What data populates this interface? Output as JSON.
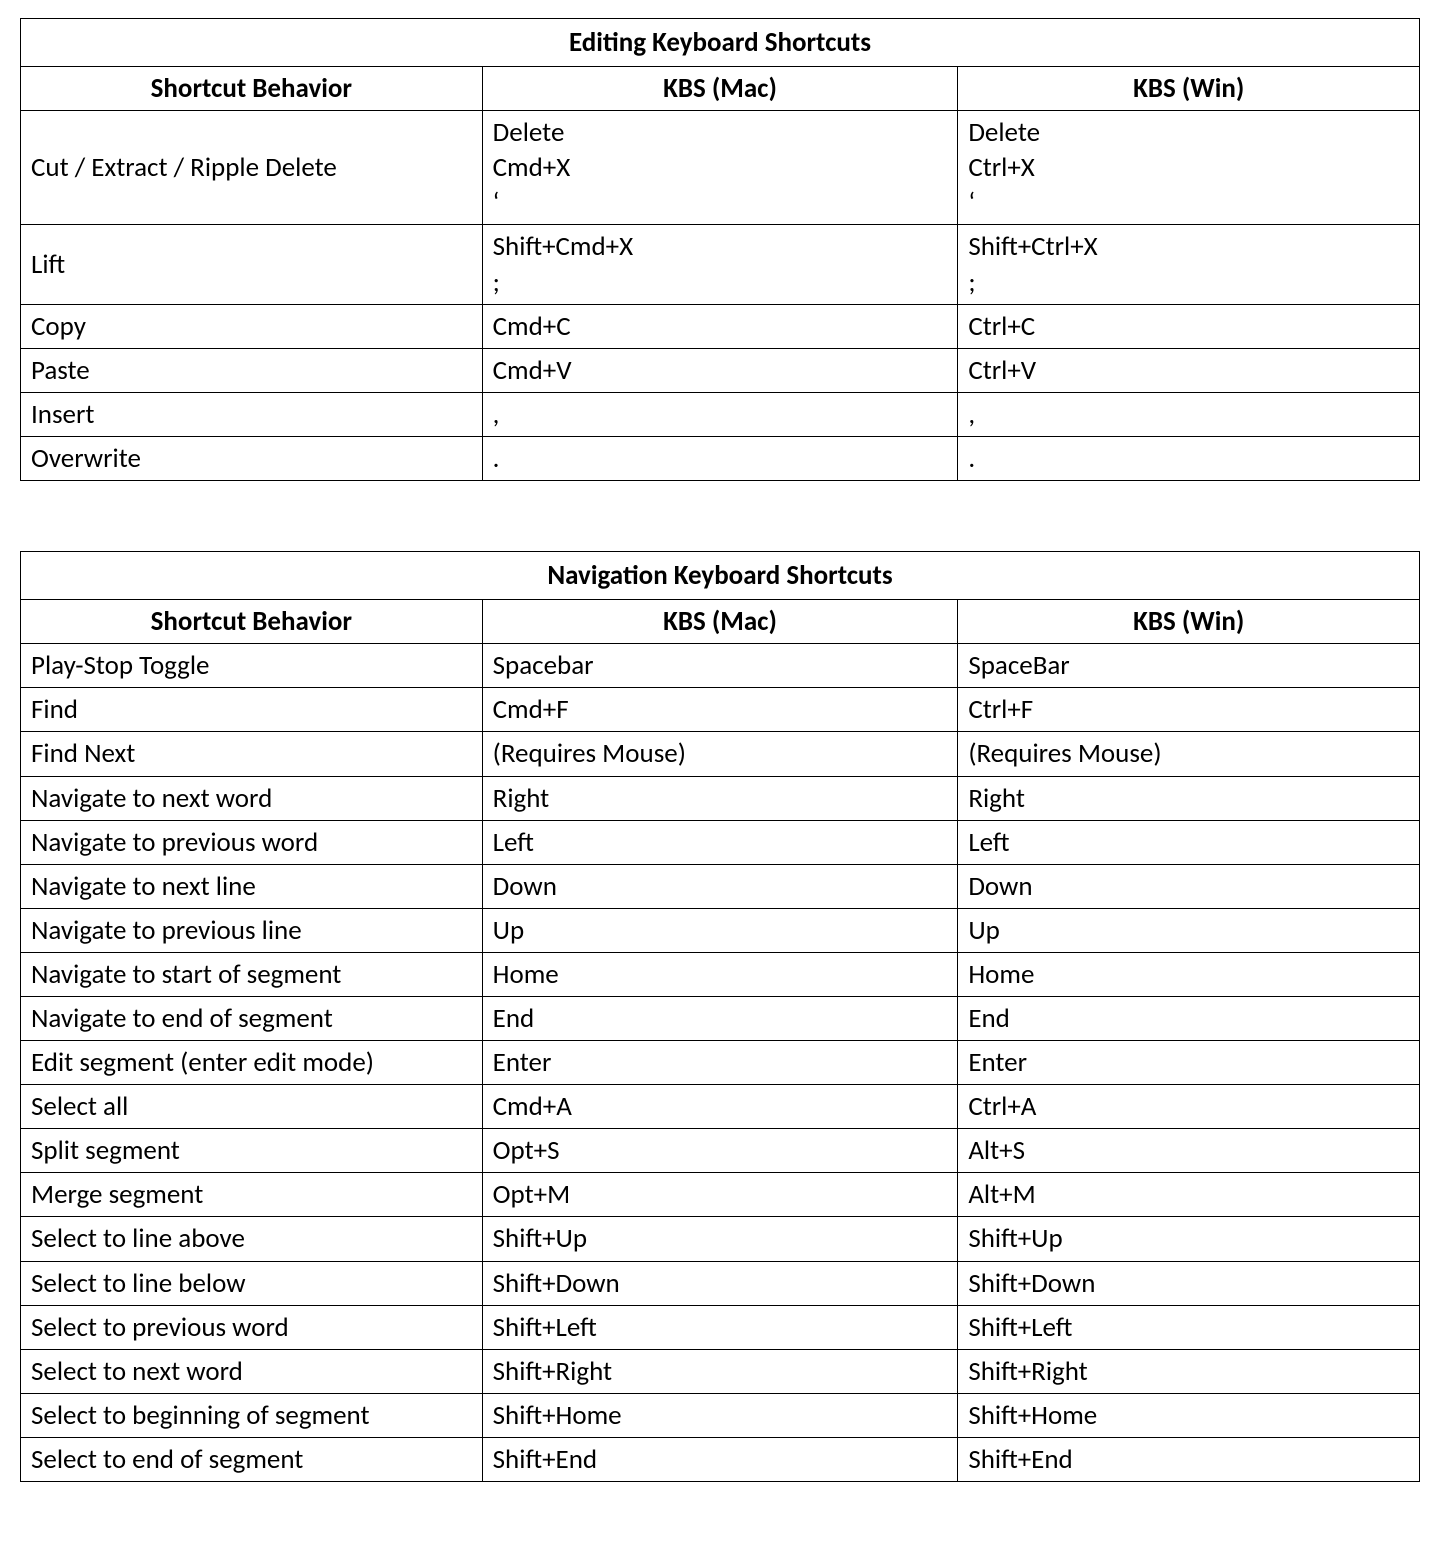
{
  "tables": [
    {
      "title": "Editing Keyboard Shortcuts",
      "columns": [
        "Shortcut Behavior",
        "KBS (Mac)",
        "KBS (Win)"
      ],
      "rows": [
        {
          "behavior": "Cut / Extract / Ripple Delete",
          "mac": [
            "Delete",
            "Cmd+X",
            "‘"
          ],
          "win": [
            "Delete",
            "Ctrl+X",
            "‘"
          ]
        },
        {
          "behavior": "Lift",
          "mac": [
            "Shift+Cmd+X",
            ";"
          ],
          "win": [
            "Shift+Ctrl+X",
            ";"
          ]
        },
        {
          "behavior": "Copy",
          "mac": [
            "Cmd+C"
          ],
          "win": [
            "Ctrl+C"
          ]
        },
        {
          "behavior": "Paste",
          "mac": [
            "Cmd+V"
          ],
          "win": [
            "Ctrl+V"
          ]
        },
        {
          "behavior": "Insert",
          "mac": [
            ","
          ],
          "win": [
            ","
          ]
        },
        {
          "behavior": "Overwrite",
          "mac": [
            "."
          ],
          "win": [
            "."
          ]
        }
      ]
    },
    {
      "title": "Navigation Keyboard Shortcuts",
      "columns": [
        "Shortcut Behavior",
        "KBS (Mac)",
        "KBS (Win)"
      ],
      "rows": [
        {
          "behavior": "Play-Stop Toggle",
          "mac": [
            "Spacebar"
          ],
          "win": [
            "SpaceBar"
          ]
        },
        {
          "behavior": "Find",
          "mac": [
            "Cmd+F"
          ],
          "win": [
            "Ctrl+F"
          ]
        },
        {
          "behavior": "Find Next",
          "mac": [
            "(Requires Mouse)"
          ],
          "win": [
            "(Requires Mouse)"
          ]
        },
        {
          "behavior": "Navigate to next word",
          "mac": [
            "Right"
          ],
          "win": [
            "Right"
          ]
        },
        {
          "behavior": "Navigate to previous word",
          "mac": [
            "Left"
          ],
          "win": [
            "Left"
          ]
        },
        {
          "behavior": "Navigate to next line",
          "mac": [
            "Down"
          ],
          "win": [
            "Down"
          ]
        },
        {
          "behavior": "Navigate to previous line",
          "mac": [
            "Up"
          ],
          "win": [
            "Up"
          ]
        },
        {
          "behavior": "Navigate to start of segment",
          "mac": [
            "Home"
          ],
          "win": [
            "Home"
          ]
        },
        {
          "behavior": "Navigate to end of segment",
          "mac": [
            "End"
          ],
          "win": [
            "End"
          ]
        },
        {
          "behavior": "Edit segment (enter edit mode)",
          "mac": [
            "Enter"
          ],
          "win": [
            "Enter"
          ]
        },
        {
          "behavior": "Select all",
          "mac": [
            "Cmd+A"
          ],
          "win": [
            "Ctrl+A"
          ]
        },
        {
          "behavior": "Split segment",
          "mac": [
            "Opt+S"
          ],
          "win": [
            "Alt+S"
          ]
        },
        {
          "behavior": "Merge segment",
          "mac": [
            "Opt+M"
          ],
          "win": [
            "Alt+M"
          ]
        },
        {
          "behavior": "Select to line above",
          "mac": [
            "Shift+Up"
          ],
          "win": [
            "Shift+Up"
          ]
        },
        {
          "behavior": "Select to line below",
          "mac": [
            "Shift+Down"
          ],
          "win": [
            "Shift+Down"
          ]
        },
        {
          "behavior": "Select to previous word",
          "mac": [
            "Shift+Left"
          ],
          "win": [
            "Shift+Left"
          ]
        },
        {
          "behavior": "Select to next word",
          "mac": [
            "Shift+Right"
          ],
          "win": [
            "Shift+Right"
          ]
        },
        {
          "behavior": "Select to beginning of segment",
          "mac": [
            "Shift+Home"
          ],
          "win": [
            "Shift+Home"
          ]
        },
        {
          "behavior": "Select to end of segment",
          "mac": [
            "Shift+End"
          ],
          "win": [
            "Shift+End"
          ]
        }
      ]
    }
  ]
}
